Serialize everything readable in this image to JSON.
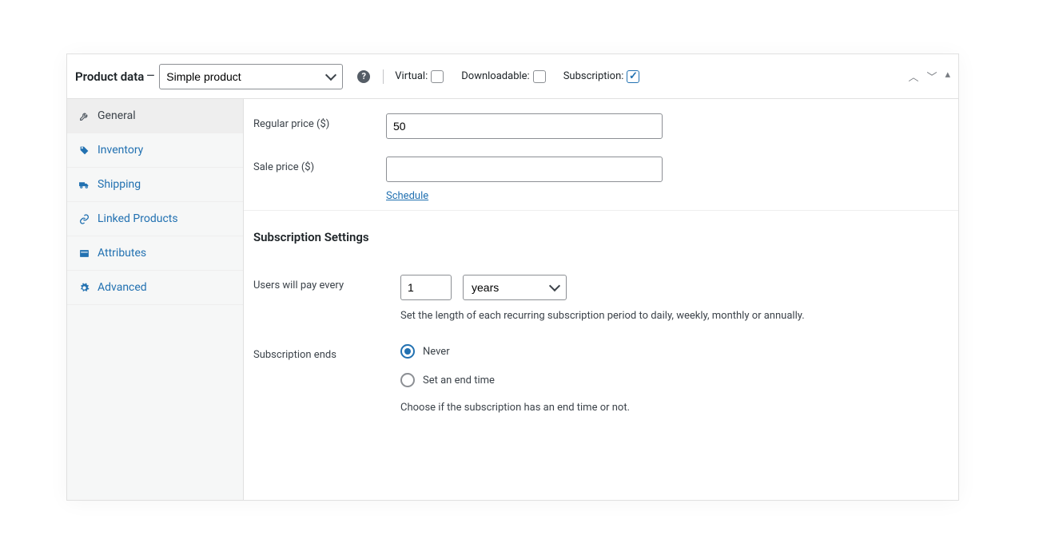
{
  "header": {
    "title": "Product data",
    "product_type": "Simple product",
    "virtual_label": "Virtual:",
    "downloadable_label": "Downloadable:",
    "subscription_label": "Subscription:",
    "virtual_checked": false,
    "downloadable_checked": false,
    "subscription_checked": true
  },
  "sidebar": {
    "items": [
      {
        "label": "General",
        "icon": "wrench-icon",
        "active": true
      },
      {
        "label": "Inventory",
        "icon": "tag-icon",
        "active": false
      },
      {
        "label": "Shipping",
        "icon": "truck-icon",
        "active": false
      },
      {
        "label": "Linked Products",
        "icon": "link-icon",
        "active": false
      },
      {
        "label": "Attributes",
        "icon": "panel-icon",
        "active": false
      },
      {
        "label": "Advanced",
        "icon": "gear-icon",
        "active": false
      }
    ]
  },
  "fields": {
    "regular_price_label": "Regular price ($)",
    "regular_price_value": "50",
    "sale_price_label": "Sale price ($)",
    "sale_price_value": "",
    "schedule_link": "Schedule"
  },
  "subscription": {
    "section_title": "Subscription Settings",
    "users_pay_label": "Users will pay every",
    "interval_value": "1",
    "period_value": "years",
    "period_helper": "Set the length of each recurring subscription period to daily, weekly, monthly or annually.",
    "ends_label": "Subscription ends",
    "radio_never": "Never",
    "radio_set_end": "Set an end time",
    "ends_selected": "never",
    "ends_helper": "Choose if the subscription has an end time or not."
  }
}
